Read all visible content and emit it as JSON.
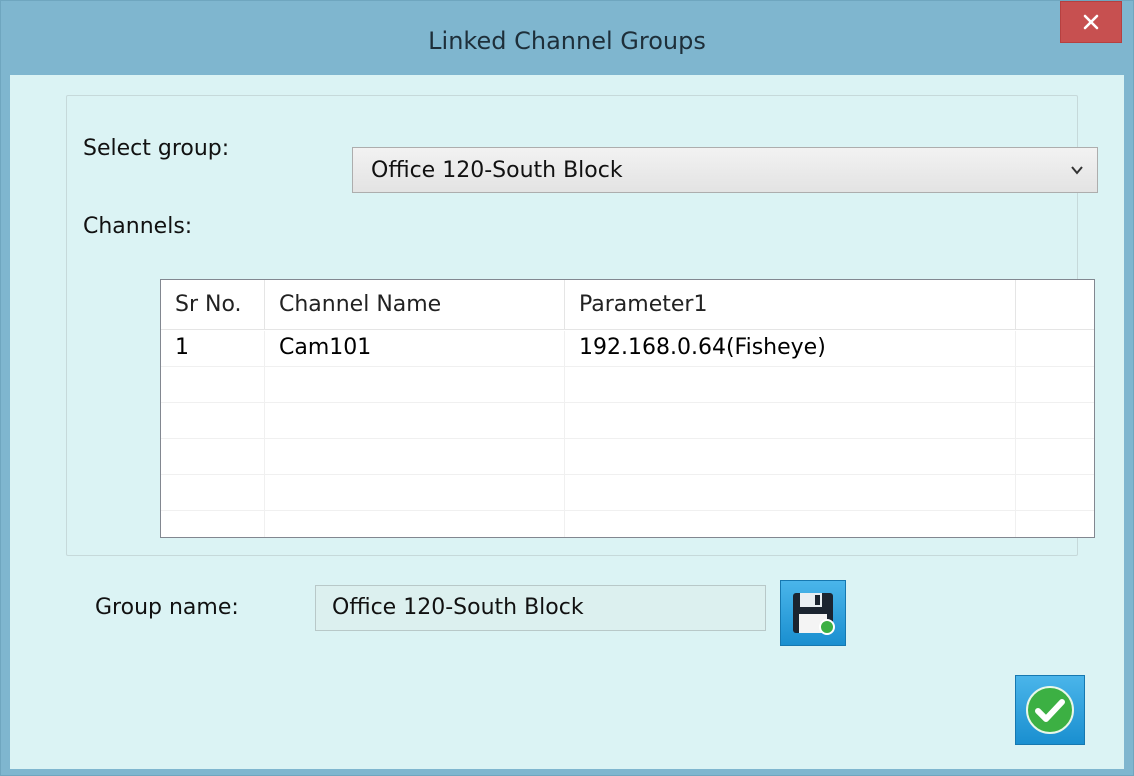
{
  "window": {
    "title": "Linked Channel Groups",
    "close_symbol": "×"
  },
  "select_group": {
    "label": "Select group:",
    "value": "Office 120-South Block",
    "icon": "chevron-down-icon"
  },
  "channels": {
    "label": "Channels:",
    "columns": [
      "Sr No.",
      "Channel Name",
      "Parameter1",
      ""
    ],
    "rows": [
      [
        "1",
        "Cam101",
        "192.168.0.64(Fisheye)",
        ""
      ],
      [
        "",
        "",
        "",
        ""
      ],
      [
        "",
        "",
        "",
        ""
      ],
      [
        "",
        "",
        "",
        ""
      ],
      [
        "",
        "",
        "",
        ""
      ],
      [
        "",
        "",
        "",
        ""
      ]
    ]
  },
  "group_name": {
    "label": "Group name:",
    "value": "Office 120-South Block"
  },
  "buttons": {
    "save_icon": "floppy-disk-icon",
    "ok_icon": "checkmark-icon"
  },
  "colors": {
    "frame": "#7fb6cf",
    "client": "#dbf3f4",
    "close": "#c75050",
    "button_blue": "#1a8fd0",
    "check_green": "#3cb043"
  }
}
